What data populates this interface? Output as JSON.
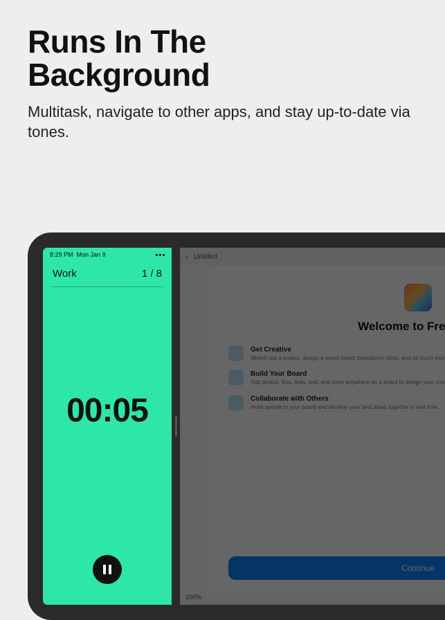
{
  "hero": {
    "title_line1": "Runs In The",
    "title_line2": "Background",
    "subtitle": "Multitask, navigate to other apps, and stay up-to-date via tones."
  },
  "status": {
    "time": "8:29 PM",
    "date": "Mon Jan 9"
  },
  "timer": {
    "label": "Work",
    "round": "1 / 8",
    "time": "00:05"
  },
  "right_pane": {
    "doc_title": "Untitled",
    "zoom": "100%"
  },
  "freeform": {
    "welcome": "Welcome to Freeform",
    "features": [
      {
        "title": "Get Creative",
        "body": "Sketch out a project, design a mood board, brainstorm ideas, and so much more."
      },
      {
        "title": "Build Your Board",
        "body": "Add photos, files, links, text, and more anywhere on a board to design your creative space."
      },
      {
        "title": "Collaborate with Others",
        "body": "Invite people to your board and develop your best ideas together in real time."
      }
    ],
    "continue": "Continue"
  }
}
